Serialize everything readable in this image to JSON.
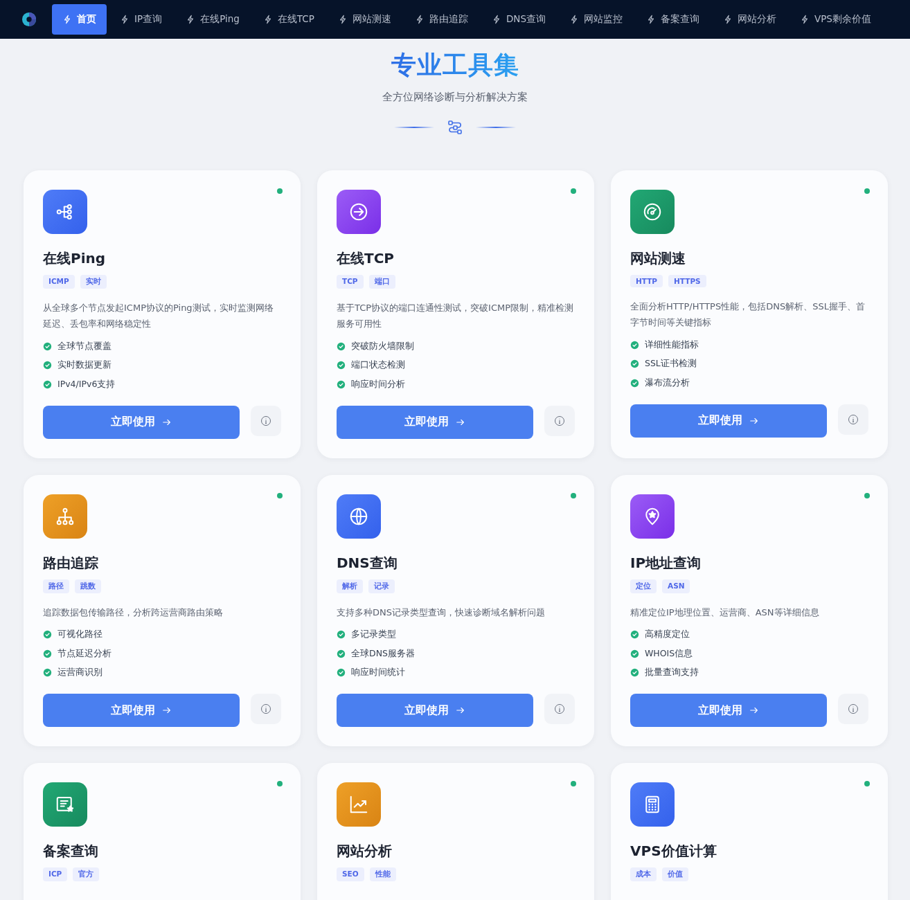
{
  "nav": {
    "items": [
      {
        "label": "首页",
        "selected": true
      },
      {
        "label": "IP查询",
        "selected": false
      },
      {
        "label": "在线Ping",
        "selected": false
      },
      {
        "label": "在线TCP",
        "selected": false
      },
      {
        "label": "网站测速",
        "selected": false
      },
      {
        "label": "路由追踪",
        "selected": false
      },
      {
        "label": "DNS查询",
        "selected": false
      },
      {
        "label": "网站监控",
        "selected": false
      },
      {
        "label": "备案查询",
        "selected": false
      },
      {
        "label": "网站分析",
        "selected": false
      },
      {
        "label": "VPS剩余价值",
        "selected": false
      }
    ]
  },
  "hero": {
    "title": "专业工具集",
    "subtitle": "全方位网络诊断与分析解决方案"
  },
  "tools": [
    {
      "title": "在线Ping",
      "tags": [
        "ICMP",
        "实时"
      ],
      "description": "从全球多个节点发起ICMP协议的Ping测试，实时监测网络延迟、丢包率和网络稳定性",
      "features": [
        "全球节点覆盖",
        "实时数据更新",
        "IPv4/IPv6支持"
      ],
      "button": "立即使用"
    },
    {
      "title": "在线TCP",
      "tags": [
        "TCP",
        "端口"
      ],
      "description": "基于TCP协议的端口连通性测试，突破ICMP限制，精准检测服务可用性",
      "features": [
        "突破防火墙限制",
        "端口状态检测",
        "响应时间分析"
      ],
      "button": "立即使用"
    },
    {
      "title": "网站测速",
      "tags": [
        "HTTP",
        "HTTPS"
      ],
      "description": "全面分析HTTP/HTTPS性能，包括DNS解析、SSL握手、首字节时间等关键指标",
      "features": [
        "详细性能指标",
        "SSL证书检测",
        "瀑布流分析"
      ],
      "button": "立即使用"
    },
    {
      "title": "路由追踪",
      "tags": [
        "路径",
        "跳数"
      ],
      "description": "追踪数据包传输路径，分析跨运营商路由策略",
      "features": [
        "可视化路径",
        "节点延迟分析",
        "运营商识别"
      ],
      "button": "立即使用"
    },
    {
      "title": "DNS查询",
      "tags": [
        "解析",
        "记录"
      ],
      "description": "支持多种DNS记录类型查询，快速诊断域名解析问题",
      "features": [
        "多记录类型",
        "全球DNS服务器",
        "响应时间统计"
      ],
      "button": "立即使用"
    },
    {
      "title": "IP地址查询",
      "tags": [
        "定位",
        "ASN"
      ],
      "description": "精准定位IP地理位置、运营商、ASN等详细信息",
      "features": [
        "高精度定位",
        "WHOIS信息",
        "批量查询支持"
      ],
      "button": "立即使用"
    },
    {
      "title": "备案查询",
      "tags": [
        "ICP",
        "官方"
      ]
    },
    {
      "title": "网站分析",
      "tags": [
        "SEO",
        "性能"
      ]
    },
    {
      "title": "VPS价值计算",
      "tags": [
        "成本",
        "价值"
      ]
    }
  ]
}
